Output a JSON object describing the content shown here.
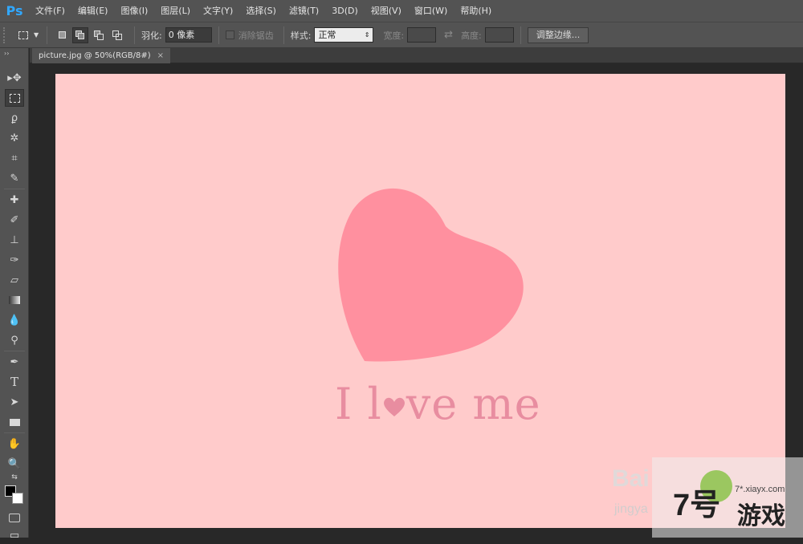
{
  "app": {
    "logo": "Ps"
  },
  "menu": [
    "文件(F)",
    "编辑(E)",
    "图像(I)",
    "图层(L)",
    "文字(Y)",
    "选择(S)",
    "滤镜(T)",
    "3D(D)",
    "视图(V)",
    "窗口(W)",
    "帮助(H)"
  ],
  "options": {
    "feather_label": "羽化:",
    "feather_value": "0 像素",
    "antialias_label": "消除锯齿",
    "style_label": "样式:",
    "style_value": "正常",
    "width_label": "宽度:",
    "height_label": "高度:",
    "refine_edge": "调整边缘..."
  },
  "document": {
    "tab_title": "picture.jpg @ 50%(RGB/8#)",
    "tab_close": "×",
    "text_pre": "I l",
    "text_post": "ve me"
  },
  "watermarks": {
    "baidu": "Bai",
    "jingyan": "jingya",
    "site_num": "7号",
    "site_game": "游戏",
    "site_url": "7*.xiayx.com"
  },
  "colors": {
    "canvas": "#ffcbcb",
    "heart": "#ff909f",
    "text": "#e88da0",
    "foreground": "#000000",
    "background": "#ffffff"
  }
}
